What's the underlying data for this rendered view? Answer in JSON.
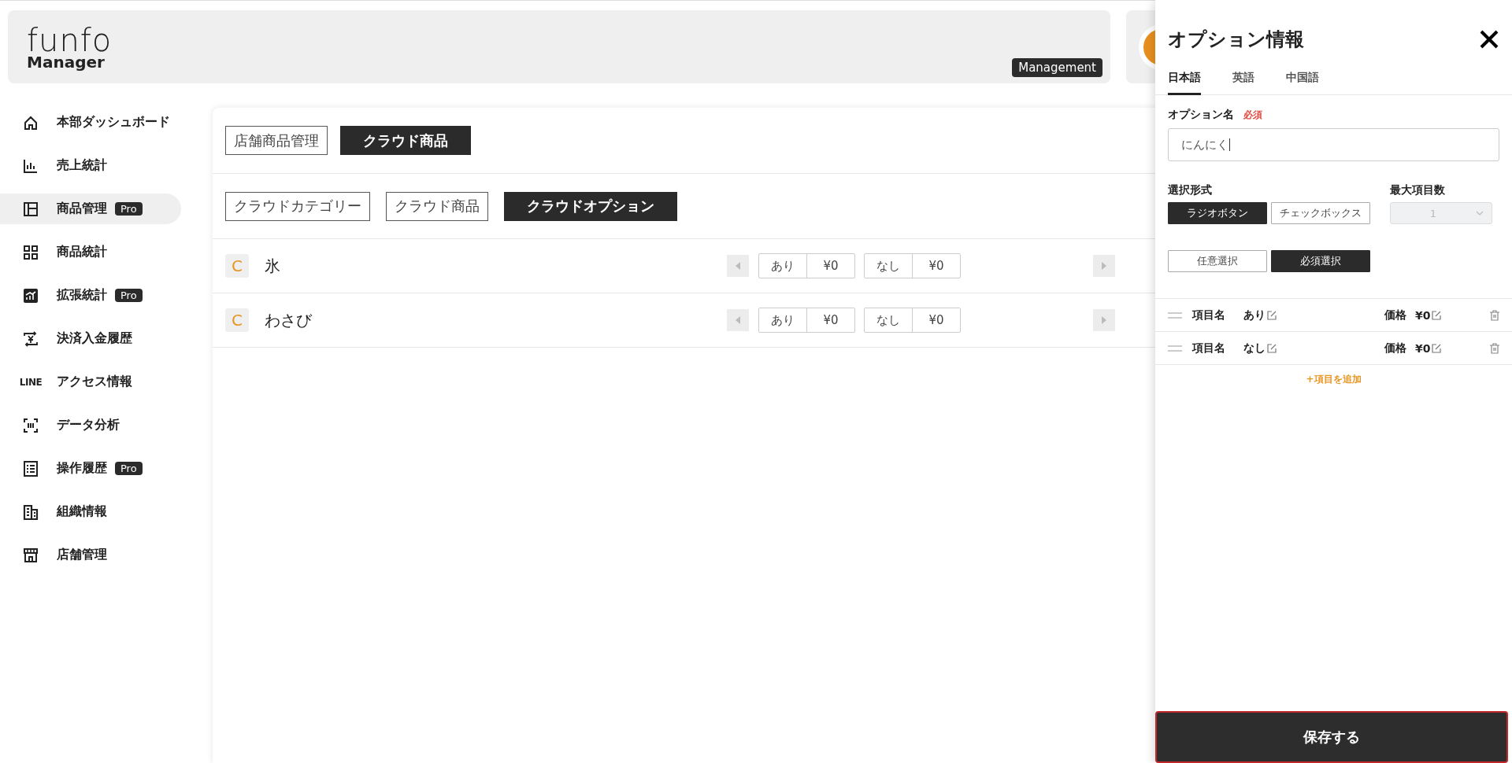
{
  "header": {
    "logo": {
      "brand": "funfo",
      "product": "Manager"
    },
    "badge": "Management"
  },
  "sidebar": {
    "items": [
      {
        "label": "本部ダッシュボード",
        "selected": false
      },
      {
        "label": "売上統計",
        "selected": false
      },
      {
        "label": "商品管理",
        "badge": "Pro",
        "selected": true
      },
      {
        "label": "商品統計",
        "selected": false
      },
      {
        "label": "拡張統計",
        "badge": "Pro",
        "selected": false
      },
      {
        "label": "決済入金履歴",
        "selected": false
      },
      {
        "label": "アクセス情報",
        "logo_text": "LINE",
        "selected": false
      },
      {
        "label": "データ分析",
        "selected": false
      },
      {
        "label": "操作履歴",
        "badge": "Pro",
        "selected": false
      },
      {
        "label": "組織情報",
        "selected": false
      },
      {
        "label": "店舗管理",
        "selected": false
      }
    ]
  },
  "main": {
    "top_tabs": [
      {
        "label": "店舗商品管理",
        "selected": false
      },
      {
        "label": "クラウド商品",
        "selected": true
      }
    ],
    "sub_tabs": [
      {
        "label": "クラウドカテゴリー",
        "selected": false
      },
      {
        "label": "クラウド商品",
        "selected": false
      },
      {
        "label": "クラウドオプション",
        "selected": true
      }
    ],
    "options": [
      {
        "badge": "C",
        "name": "氷",
        "choices": [
          {
            "label": "あり",
            "price": "¥0"
          },
          {
            "label": "なし",
            "price": "¥0"
          }
        ]
      },
      {
        "badge": "C",
        "name": "わさび",
        "choices": [
          {
            "label": "あり",
            "price": "¥0"
          },
          {
            "label": "なし",
            "price": "¥0"
          }
        ]
      }
    ]
  },
  "panel": {
    "title": "オプション情報",
    "language_tabs": [
      {
        "label": "日本語",
        "selected": true
      },
      {
        "label": "英語",
        "selected": false
      },
      {
        "label": "中国語",
        "selected": false
      }
    ],
    "option_name": {
      "label": "オプション名",
      "required": "必須",
      "value": "にんにく"
    },
    "selection_type": {
      "label": "選択形式",
      "options": [
        {
          "label": "ラジオボタン",
          "selected": true
        },
        {
          "label": "チェックボックス",
          "selected": false
        }
      ]
    },
    "max_items": {
      "label": "最大項目数",
      "value": "1",
      "disabled": true
    },
    "requirement": [
      {
        "label": "任意選択",
        "selected": false
      },
      {
        "label": "必須選択",
        "selected": true
      }
    ],
    "items": [
      {
        "name_label": "項目名",
        "name": "あり",
        "price_label": "価格",
        "price": "¥0"
      },
      {
        "name_label": "項目名",
        "name": "なし",
        "price_label": "価格",
        "price": "¥0"
      }
    ],
    "add_item": "+項目を追加",
    "save": "保存する"
  }
}
